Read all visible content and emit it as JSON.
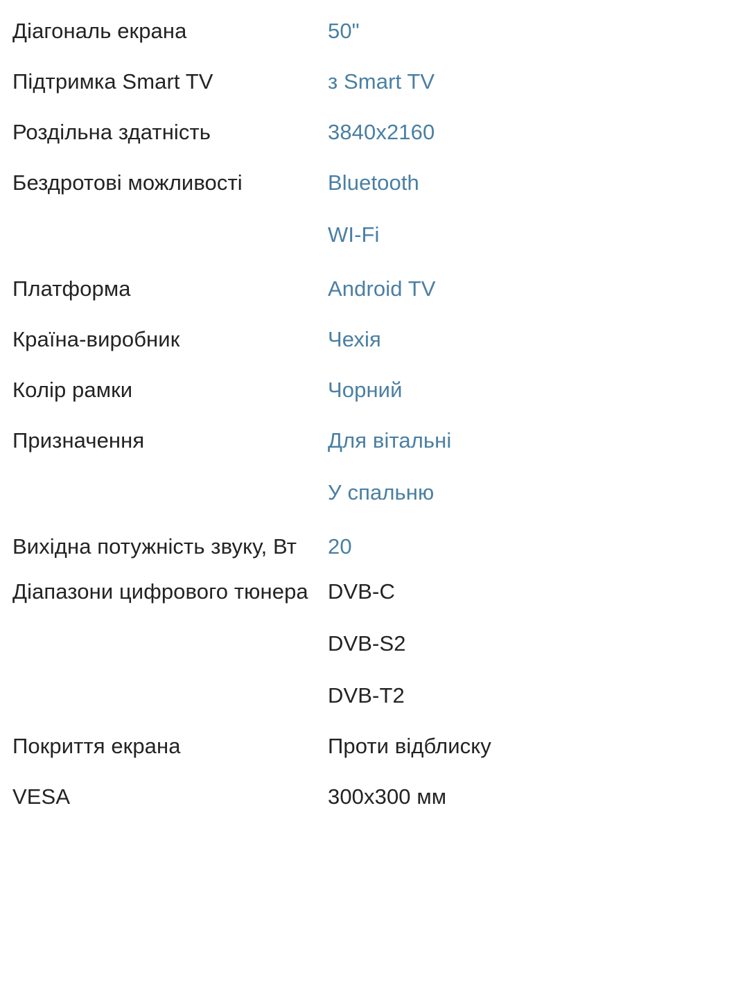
{
  "theme": {
    "background": "#ffffff",
    "label_color": "#232323",
    "link_value_color": "#4a7fa3",
    "plain_value_color": "#232323"
  },
  "spec_table": {
    "rows": [
      {
        "label": "Діагональ екрана",
        "values": [
          "50\""
        ],
        "value_style": "link"
      },
      {
        "label": "Підтримка Smart TV",
        "values": [
          "з Smart TV"
        ],
        "value_style": "link"
      },
      {
        "label": "Роздільна здатність",
        "values": [
          "3840x2160"
        ],
        "value_style": "link"
      },
      {
        "label": "Бездротові можливості",
        "values": [
          "Bluetooth",
          "WI-Fi"
        ],
        "value_style": "link"
      },
      {
        "label": "Платформа",
        "values": [
          "Android TV"
        ],
        "value_style": "link"
      },
      {
        "label": "Країна-виробник",
        "values": [
          "Чехія"
        ],
        "value_style": "link"
      },
      {
        "label": "Колір рамки",
        "values": [
          "Чорний"
        ],
        "value_style": "link"
      },
      {
        "label": "Призначення",
        "values": [
          "Для вітальні",
          "У спальню"
        ],
        "value_style": "link"
      },
      {
        "label": "Вихідна потужність звуку, Вт",
        "values": [
          "20"
        ],
        "value_style": "link"
      },
      {
        "label": "Діапазони цифрового тюнера",
        "values": [
          "DVB-C",
          "DVB-S2",
          "DVB-T2"
        ],
        "value_style": "plain"
      },
      {
        "label": "Покриття екрана",
        "values": [
          "Проти відблиску"
        ],
        "value_style": "plain"
      },
      {
        "label": "VESA",
        "values": [
          "300x300 мм"
        ],
        "value_style": "plain"
      }
    ]
  }
}
